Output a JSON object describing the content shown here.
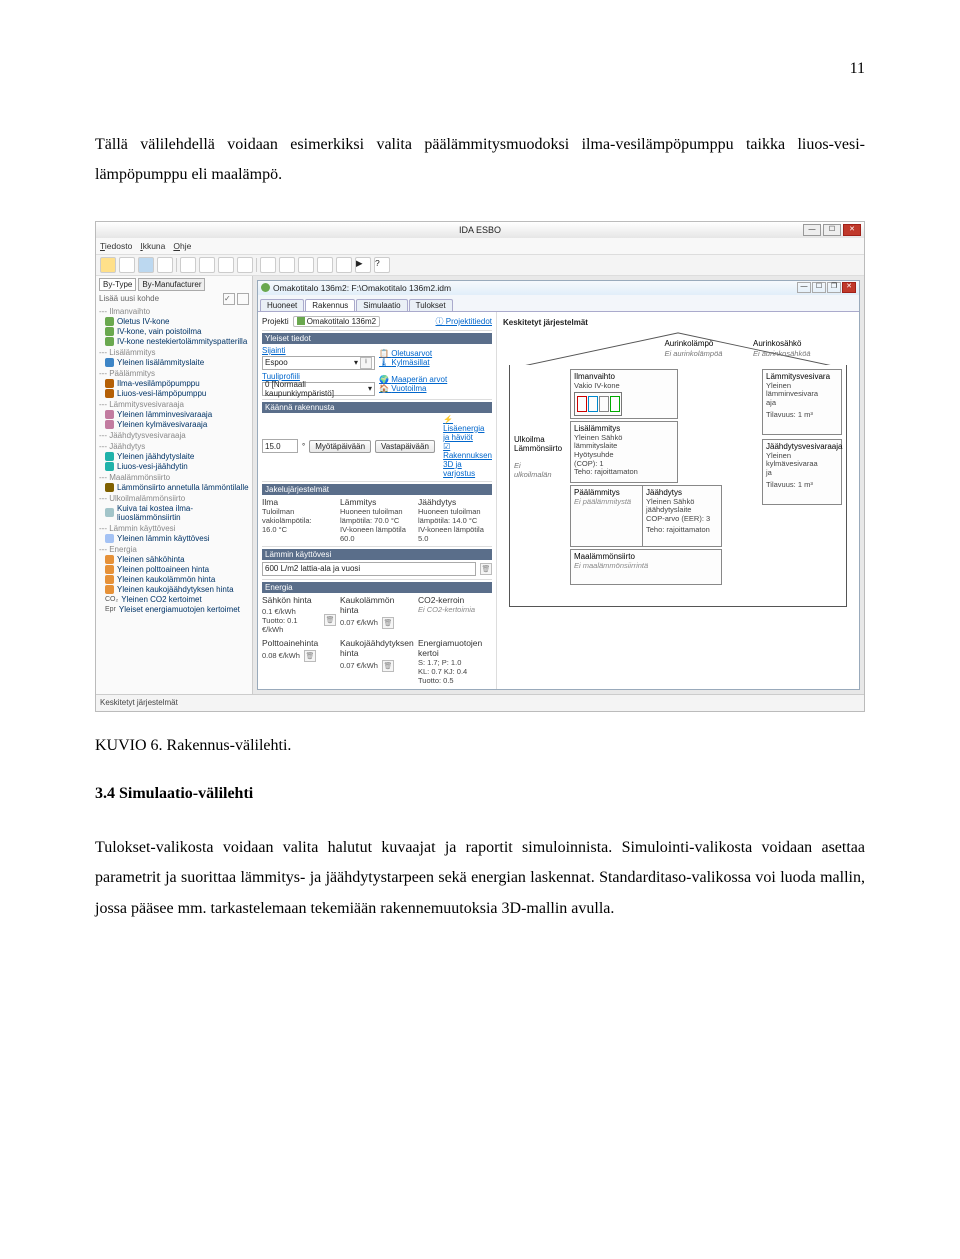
{
  "page_number": "11",
  "para1": "Tällä välilehdellä voidaan esimerkiksi valita päälämmitysmuodoksi ilma-vesilämpöpumppu taikka liuos-vesi-lämpöpumppu eli maalämpö.",
  "caption": "KUVIO 6. Rakennus-välilehti.",
  "heading": "3.4  Simulaatio-välilehti",
  "para2": "Tulokset-valikosta voidaan valita halutut kuvaajat ja raportit simuloinnista. Simulointi-valikosta voidaan asettaa parametrit ja suorittaa lämmitys- ja jäähdytystarpeen sekä energian laskennat. Standarditaso-valikossa voi luoda mallin, jossa pääsee mm. tarkastelemaan tekemiään rakennemuutoksia 3D-mallin avulla.",
  "app": {
    "title": "IDA ESBO",
    "menu": {
      "tiedosto": "Tiedosto",
      "ikkuna": "Ikkuna",
      "ohje": "Ohje"
    },
    "bottom": "Keskitetyt järjestelmät"
  },
  "sidebar": {
    "tabs": {
      "bytype": "By-Type",
      "bymfr": "By-Manufacturer"
    },
    "add": "Lisää uusi kohde",
    "groups": [
      {
        "name": "--- Ilmanvaihto",
        "items": [
          {
            "ic": "#6aa84f",
            "t": "Oletus IV-kone"
          },
          {
            "ic": "#6aa84f",
            "t": "IV-kone, vain poistoilma"
          },
          {
            "ic": "#6aa84f",
            "t": "IV-kone nestekiertolämmityspatterilla"
          }
        ]
      },
      {
        "name": "--- Lisälämmitys",
        "items": [
          {
            "ic": "#3d85c6",
            "t": "Yleinen lisälämmityslaite"
          }
        ]
      },
      {
        "name": "--- Päälämmitys",
        "items": [
          {
            "ic": "#b45f06",
            "t": "Ilma-vesilämpöpumppu"
          },
          {
            "ic": "#b45f06",
            "t": "Liuos-vesi-lämpöpumppu"
          }
        ]
      },
      {
        "name": "--- Lämmitysvesivaraaja",
        "items": [
          {
            "ic": "#c27ba0",
            "t": "Yleinen lämminvesivaraaja"
          },
          {
            "ic": "#c27ba0",
            "t": "Yleinen kylmävesivaraaja"
          }
        ]
      },
      {
        "name": "--- Jäähdytysvesivaraaja",
        "items": []
      },
      {
        "name": "--- Jäähdytys",
        "items": [
          {
            "ic": "#20b2aa",
            "t": "Yleinen jäähdytyslaite"
          },
          {
            "ic": "#20b2aa",
            "t": "Liuos-vesi-jäähdytin"
          }
        ]
      },
      {
        "name": "--- Maalämmönsiirto",
        "items": [
          {
            "ic": "#7f6000",
            "t": "Lämmönsiirto annetulla lämmöntilalle"
          }
        ]
      },
      {
        "name": "--- Ulkoilmalämmönsiirto",
        "items": [
          {
            "ic": "#a2c4c9",
            "t": "Kuiva tai kostea ilma- liuoslämmönsiirtin"
          }
        ]
      },
      {
        "name": "--- Lämmin käyttövesi",
        "items": [
          {
            "ic": "#a4c2f4",
            "t": "Yleinen lämmin käyttövesi"
          }
        ]
      },
      {
        "name": "--- Energia",
        "items": [
          {
            "ic": "#e69138",
            "t": "Yleinen sähköhinta"
          },
          {
            "ic": "#e69138",
            "t": "Yleinen polttoaineen hinta"
          },
          {
            "ic": "#e69138",
            "t": "Yleinen kaukolämmön hinta"
          },
          {
            "ic": "#e69138",
            "t": "Yleinen kaukojäähdytyksen hinta"
          },
          {
            "ic": "#888",
            "t": "Yleinen CO2 kertoimet",
            "pre": "CO₂"
          },
          {
            "ic": "#888",
            "t": "Yleiset energiamuotojen kertoimet",
            "pre": "Epr"
          }
        ]
      }
    ]
  },
  "child": {
    "title": "Omakotitalo 136m2: F:\\Omakotitalo 136m2.idm",
    "tabs": [
      "Huoneet",
      "Rakennus",
      "Simulaatio",
      "Tulokset"
    ],
    "active_tab": 1,
    "proj_label": "Projekti",
    "proj_name": "Omakotitalo 136m2",
    "proj_link": "Projektitiedot",
    "yleiset": {
      "title": "Yleiset tiedot",
      "sijainti_lbl": "Sijainti",
      "sijainti_val": "Espoo",
      "tuuli_lbl": "Tuuliprofiili",
      "tuuli_val": "0 [Normaali kaupunkiympäristö]",
      "links": {
        "oletus": "Oletusarvot",
        "kylma": "Kylmäsillat",
        "maaperan": "Maaperän arvot",
        "vuotoilma": "Vuotoilma",
        "lisaen": "Lisäenergia ja häviöt",
        "raken3d": "Rakennuksen 3D ja varjostus"
      }
    },
    "kaanna": {
      "title": "Käännä rakennusta",
      "val": "15.0",
      "b1": "Myötäpäivään",
      "b2": "Vastapäivään"
    },
    "jakelu": {
      "title": "Jakelujärjestelmät",
      "c1": {
        "h": "Ilma",
        "l": "Tuloilman vakiolämpötila:",
        "v": "16.0 °C"
      },
      "c2": {
        "h": "Lämmitys",
        "l": "Huoneen tuloilman lämpötila: 70.0 °C",
        "v": "IV-koneen lämpötila 60.0"
      },
      "c3": {
        "h": "Jäähdytys",
        "l": "Huoneen tuloilman lämpötila: 14.0 °C",
        "v": "IV-koneen lämpötila 5.0"
      }
    },
    "lammin": {
      "title": "Lämmin käyttövesi",
      "val": "600 L/m2 lattia-ala ja vuosi"
    },
    "energia": {
      "title": "Energia",
      "c1": {
        "h": "Sähkön hinta",
        "l1": "0.1 €/kWh",
        "l2": "Tuotto: 0.1 €/kWh"
      },
      "c2": {
        "h": "Kaukolämmön hinta",
        "v": "0.07 €/kWh"
      },
      "c3": {
        "h": "CO2-kerroin",
        "v": "Ei CO2-kertoimia"
      },
      "c4": {
        "h": "Polttoainehinta",
        "v": "0.08 €/kWh"
      },
      "c5": {
        "h": "Kaukojäähdytyksen hinta",
        "v": "0.07 €/kWh"
      },
      "c6": {
        "h": "Energiamuotojen kertoi",
        "v": "S: 1.7; P: 1.0\nKL: 0.7 KJ: 0.4\nTuotto: 0.5"
      }
    }
  },
  "diag": {
    "title": "Keskitetyt järjestelmät",
    "roof1": {
      "t": "Aurinkolämpö",
      "v": "Ei aurinkolämpöä"
    },
    "roof2": {
      "t": "Aurinkosähkö",
      "v": "Ei aurinkosähköä"
    },
    "ilman": {
      "t": "Ilmanvaihto",
      "sub": "Vakio IV-kone"
    },
    "lvar": {
      "t": "Lämmitysvesivara",
      "sub": "Yleinen lämminvesivara\naja",
      "vol": "Tilavuus: 1 m³"
    },
    "lisal": {
      "t": "Lisälämmitys",
      "sub": "Yleinen Sähkö\nlämmityslaite\nHyötysuhde\n(COP): 1\nTeho: rajoittamaton"
    },
    "paa": {
      "t": "Päälämmitys",
      "v": "Ei päälämmitystä"
    },
    "jaa": {
      "t": "Jäähdytys",
      "sub": "Yleinen Sähkö\njäähdytyslaite\nCOP-arvo (EER): 3",
      "tv": "Teho: rajoittamaton"
    },
    "jvar": {
      "t": "Jäähdytysvesivaraaja",
      "sub": "Yleinen\nkylmävesivaraa\nja",
      "vol": "Tilavuus: 1 m³"
    },
    "maa": {
      "t": "Maalämmönsiirto",
      "v": "Ei maalämmönsiirrintä"
    },
    "ulko": {
      "t": "Ulkoilma\nLämmönsiirto",
      "v": "Ei\nulkoilmalän"
    }
  }
}
